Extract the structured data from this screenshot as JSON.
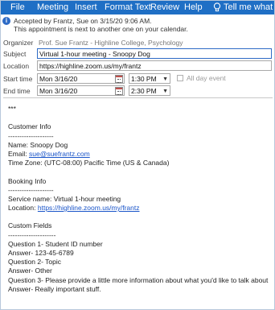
{
  "ribbon": {
    "tabs": [
      "File",
      "Meeting",
      "Insert",
      "Format Text",
      "Review",
      "Help"
    ],
    "tell_me": "Tell me what you w"
  },
  "infobar": {
    "line1": "Accepted by Frantz, Sue on 3/15/20 9:06 AM.",
    "line2": "This appointment is next to another one on your calendar."
  },
  "form": {
    "organizer_label": "Organizer",
    "organizer_value": "Prof. Sue Frantz - Highline College, Psychology",
    "subject_label": "Subject",
    "subject_value": "Virtual 1-hour meeting - Snoopy Dog",
    "location_label": "Location",
    "location_value": "https://highline.zoom.us/my/frantz",
    "start_label": "Start time",
    "start_date": "Mon 3/16/20",
    "start_time": "1:30 PM",
    "end_label": "End time",
    "end_date": "Mon 3/16/20",
    "end_time": "2:30 PM",
    "all_day_label": "All day event"
  },
  "body": {
    "stars": "***",
    "customer_heading": "Customer Info",
    "dash1": "--------------------",
    "name_line": "Name: Snoopy Dog",
    "email_prefix": "Email: ",
    "email": "sue@suefrantz.com",
    "timezone": "Time Zone: (UTC-08:00) Pacific Time (US & Canada)",
    "booking_heading": "Booking Info",
    "dash2": "--------------------",
    "service": "Service name: Virtual 1-hour meeting",
    "location_prefix": "Location: ",
    "location_link": "https://highline.zoom.us/my/frantz",
    "custom_heading": "Custom Fields",
    "dash3": "---------------------",
    "q1": "Question 1- Student ID number",
    "a1": "Answer- 123-45-6789",
    "q2": "Question 2- Topic",
    "a2": "Answer- Other",
    "q3": "Question 3- Please provide a little more information about what you'd like to talk about",
    "a3": "Answer- Really important stuff."
  }
}
